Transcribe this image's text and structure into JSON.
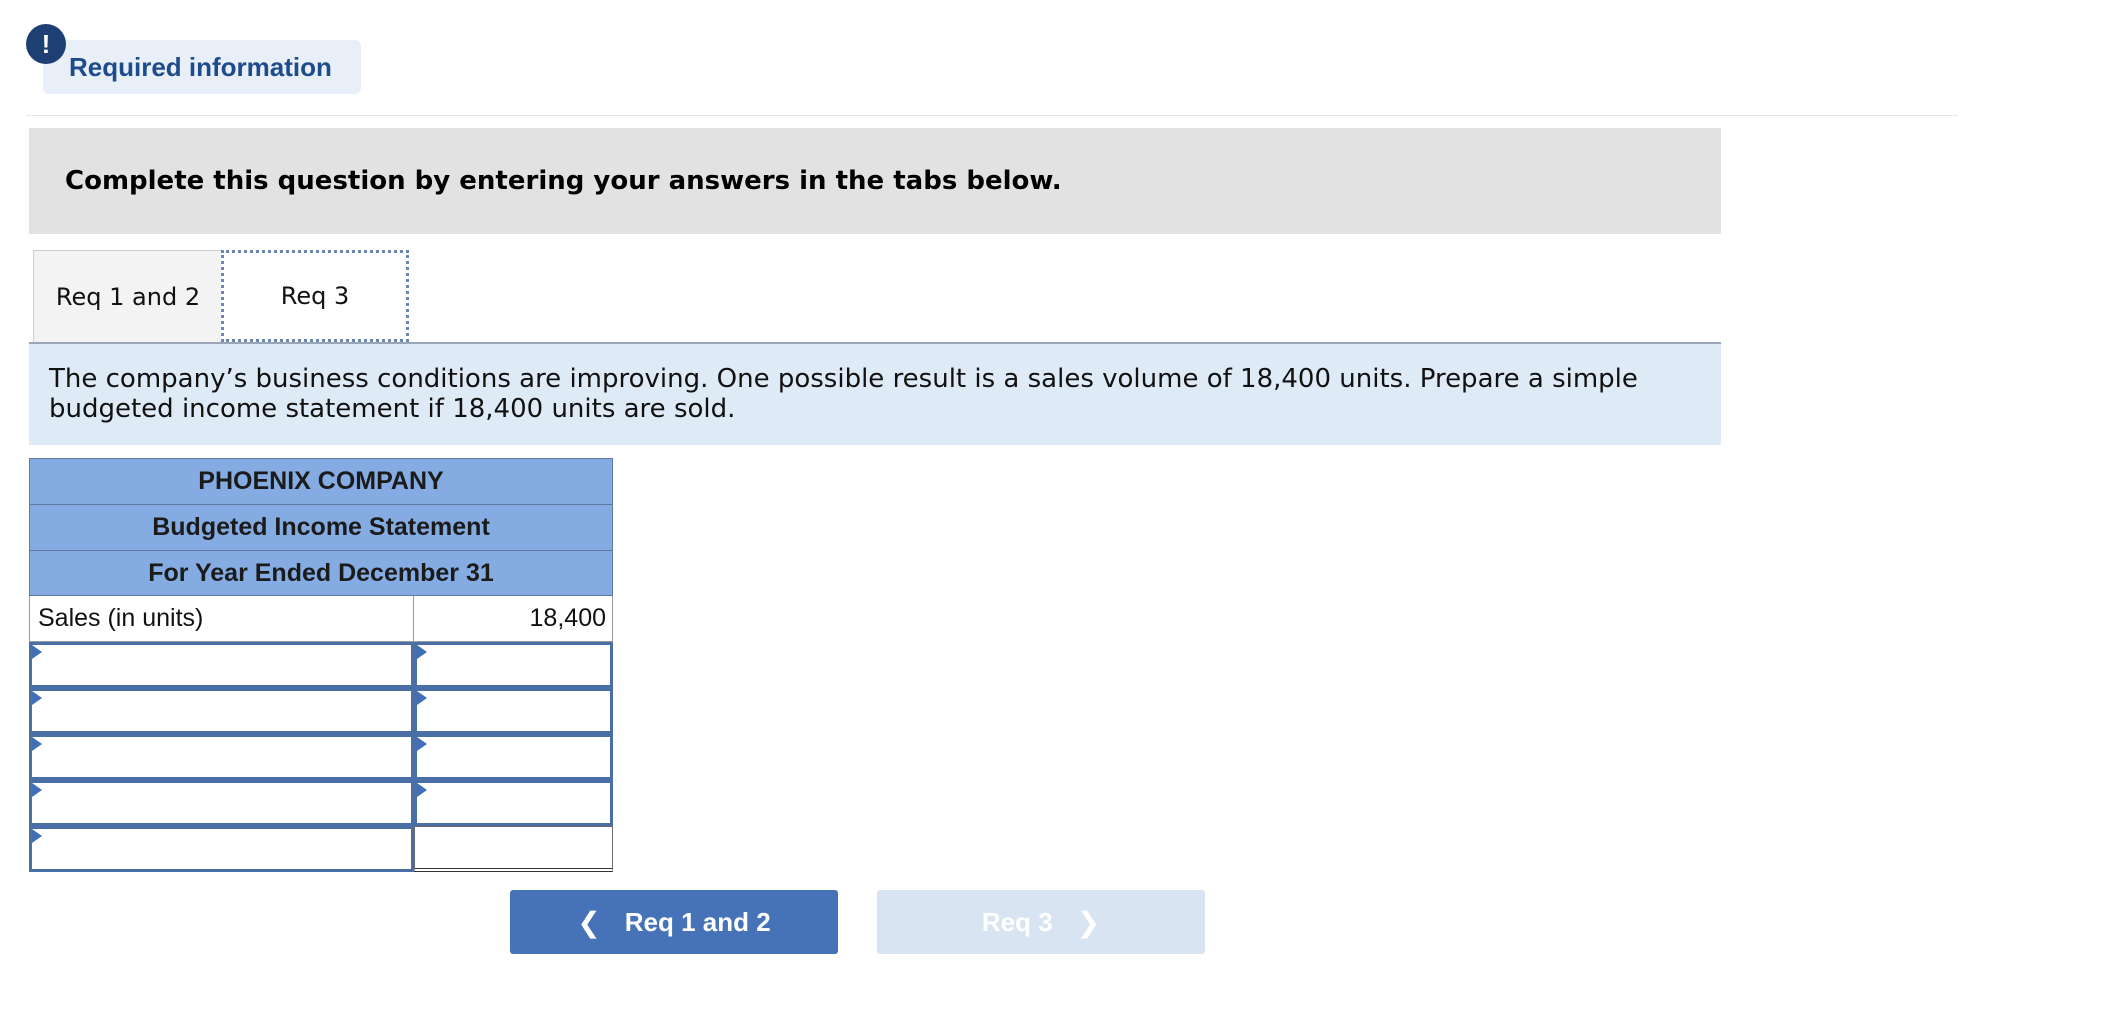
{
  "header": {
    "alert_glyph": "!",
    "required_info_label": "Required information"
  },
  "instruction": {
    "text": "Complete this question by entering your answers in the tabs below."
  },
  "tabs": [
    {
      "label": "Req 1 and 2",
      "active": false
    },
    {
      "label": "Req 3",
      "active": true
    }
  ],
  "question": {
    "text": "The company’s business conditions are improving. One possible result is a sales volume of 18,400 units. Prepare a simple budgeted income statement if 18,400 units are sold."
  },
  "statement": {
    "company": "PHOENIX COMPANY",
    "title": "Budgeted Income Statement",
    "period": "For Year Ended December 31",
    "sales_label": "Sales (in units)",
    "sales_value": "18,400",
    "input_rows": [
      {
        "label": "",
        "value": ""
      },
      {
        "label": "",
        "value": ""
      },
      {
        "label": "",
        "value": ""
      },
      {
        "label": "",
        "value": ""
      },
      {
        "label": "",
        "value": ""
      }
    ]
  },
  "navigation": {
    "prev_label": "Req 1 and 2",
    "next_label": "Req 3",
    "prev_icon": "chevron-left-icon",
    "next_icon": "chevron-right-icon"
  },
  "colors": {
    "brand_blue": "#4673b7",
    "header_blue": "#85ace2",
    "question_bg": "#dfeaf7",
    "instruction_bg": "#e2e2e2"
  }
}
